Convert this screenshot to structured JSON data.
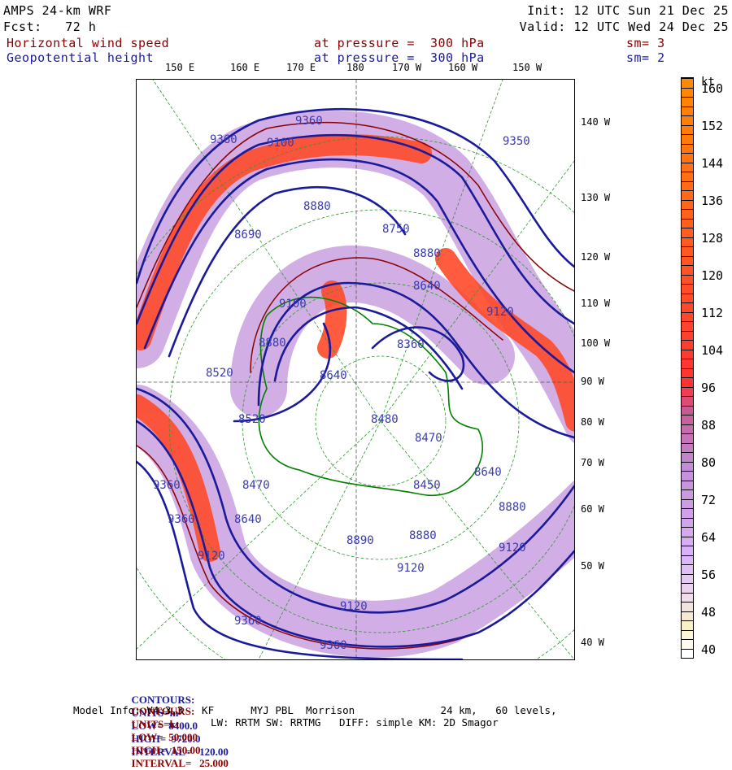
{
  "header": {
    "model": "AMPS 24-km WRF",
    "forecast": "Fcst:   72 h",
    "init": "Init: 12 UTC Sun 21 Dec 25",
    "valid": "Valid: 12 UTC Wed 24 Dec 25",
    "field1": {
      "name": "Horizontal wind speed",
      "level": "at pressure =  300 hPa",
      "smooth": "sm= 3"
    },
    "field2": {
      "name": "Geopotential height",
      "level": "at pressure =  300 hPa",
      "smooth": "sm= 2"
    }
  },
  "map": {
    "lon_labels": [
      "150 E",
      "160 E",
      "170 E",
      "180",
      "170 W",
      "160 W",
      "150 W"
    ],
    "lat_labels": [
      "140 W",
      "130 W",
      "120 W",
      "110 W",
      "100 W",
      "90 W",
      "80 W",
      "70 W",
      "60 W",
      "50 W",
      "40 W"
    ],
    "height_labels": [
      "9360",
      "9100",
      "9360",
      "8880",
      "8750",
      "8880",
      "8640",
      "9120",
      "9350",
      "8690",
      "8520",
      "8640",
      "8520",
      "8480",
      "8470",
      "8450",
      "8640",
      "8880",
      "9120",
      "9360",
      "9360",
      "8470",
      "8890",
      "8880",
      "9120",
      "9360",
      "9120",
      "9360",
      "9100",
      "8880",
      "8360",
      "9120",
      "8640"
    ],
    "colors": {
      "wind_contour": "#8b0000",
      "height_contour": "#1a1a9a",
      "coast": "#008000"
    }
  },
  "colorbar": {
    "unit": "kt",
    "min": 40,
    "max": 164,
    "step": 2,
    "labels": [
      "160",
      "152",
      "144",
      "136",
      "128",
      "120",
      "112",
      "104",
      "96",
      "88",
      "80",
      "72",
      "64",
      "56",
      "48",
      "40"
    ]
  },
  "footer": {
    "c1": {
      "label": "CONTOURS:",
      "units": "UNITS=m",
      "low": "LOW=  8400.0",
      "high": "HIGH=  9720.0",
      "interval": "INTERVAL=   120.00"
    },
    "c2": {
      "label": "CONTOURS:",
      "units": "UNITS=kt",
      "low": "LOW=  50.000",
      "high": "HIGH=  150.00",
      "interval": "INTERVAL=   25.000"
    },
    "model_info": "Model Info: V4.3.3   KF      MYJ PBL  Morrison              24 km,   60 levels,",
    "model_info2": "LW: RRTM SW: RRTMG   DIFF: simple KM: 2D Smagor"
  }
}
